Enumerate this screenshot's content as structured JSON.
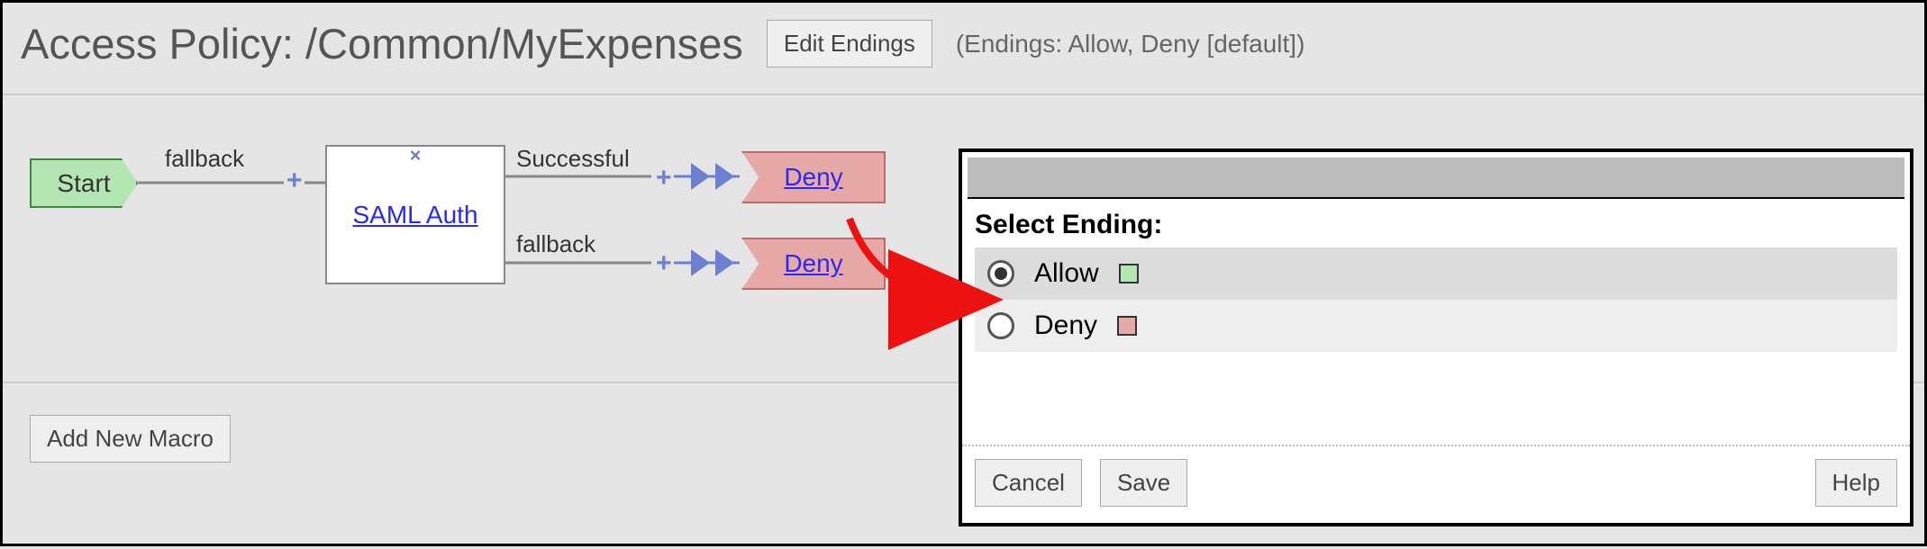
{
  "header": {
    "title": "Access Policy: /Common/MyExpenses",
    "edit_endings_label": "Edit Endings",
    "endings_note": "(Endings: Allow, Deny [default])"
  },
  "flow": {
    "start_label": "Start",
    "saml_label": "SAML Auth",
    "edges": {
      "fallback1": "fallback",
      "successful": "Successful",
      "fallback2": "fallback"
    },
    "deny1_label": "Deny",
    "deny2_label": "Deny"
  },
  "macro": {
    "add_label": "Add New Macro"
  },
  "dialog": {
    "heading": "Select Ending:",
    "options": [
      {
        "label": "Allow",
        "selected": true,
        "swatch": "allow"
      },
      {
        "label": "Deny",
        "selected": false,
        "swatch": "deny"
      }
    ],
    "cancel_label": "Cancel",
    "save_label": "Save",
    "help_label": "Help"
  }
}
